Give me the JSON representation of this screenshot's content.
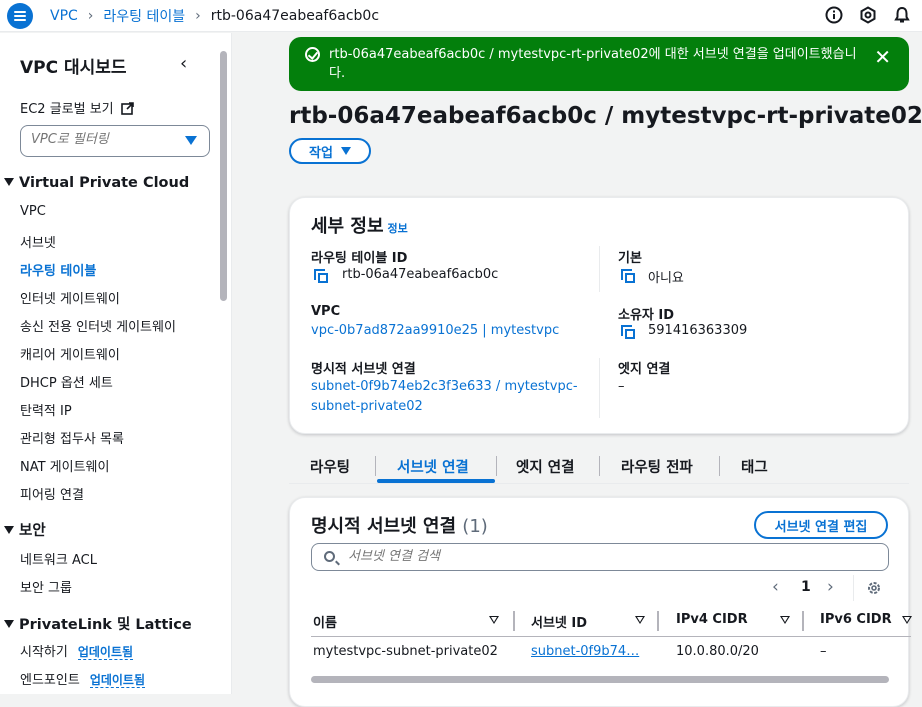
{
  "breadcrumb": {
    "root": "VPC",
    "parent": "라우팅 테이블",
    "current": "rtb-06a47eabeaf6acb0c"
  },
  "top_icons": [
    "info-circle-icon",
    "settings-icon",
    "notifications-icon"
  ],
  "sidebar": {
    "title": "VPC 대시보드",
    "ec2_link": "EC2 글로벌 보기",
    "filter_placeholder": "VPC로 필터링",
    "section_vpc": "Virtual Private Cloud",
    "items": [
      "VPC",
      "서브넷",
      "라우팅 테이블",
      "인터넷 게이트웨이",
      "송신 전용 인터넷 게이트웨이",
      "캐리어 게이트웨이",
      "DHCP 옵션 세트",
      "탄력적 IP",
      "관리형 접두사 목록",
      "NAT 게이트웨이",
      "피어링 연결"
    ],
    "section_security": "보안",
    "security_items": [
      "네트워크 ACL",
      "보안 그룹"
    ],
    "section_privatelink": "PrivateLink 및 Lattice",
    "privatelink_items": [
      {
        "label": "시작하기",
        "badge": "업데이트됨"
      },
      {
        "label": "엔드포인트",
        "badge": "업데이트됨"
      }
    ]
  },
  "flash": {
    "message": "rtb-06a47eabeaf6acb0c / mytestvpc-rt-private02에 대한 서브넷 연결을 업데이트했습니다."
  },
  "page": {
    "title": "rtb-06a47eabeaf6acb0c / mytestvpc-rt-private02",
    "actions_label": "작업"
  },
  "details": {
    "heading": "세부 정보",
    "info": "정보",
    "route_table_id_label": "라우팅 테이블 ID",
    "route_table_id": "rtb-06a47eabeaf6acb0c",
    "main_label": "기본",
    "main_value": "아니요",
    "vpc_label": "VPC",
    "vpc_value": "vpc-0b7ad872aa9910e25 | mytestvpc",
    "owner_label": "소유자 ID",
    "owner_value": "591416363309",
    "explicit_label": "명시적 서브넷 연결",
    "explicit_line1": "subnet-0f9b74eb2c3f3e633 / mytestvpc-",
    "explicit_line2": "subnet-private02",
    "edge_label": "엣지 연결",
    "edge_value": "–"
  },
  "tabs": [
    "라우팅",
    "서브넷 연결",
    "엣지 연결",
    "라우팅 전파",
    "태그"
  ],
  "assoc": {
    "heading": "명시적 서브넷 연결",
    "count": "(1)",
    "edit_label": "서브넷 연결 편집",
    "search_placeholder": "서브넷 연결 검색",
    "page": "1",
    "columns": [
      "이름",
      "서브넷 ID",
      "IPv4 CIDR",
      "IPv6 CIDR"
    ],
    "rows": [
      {
        "name": "mytestvpc-subnet-private02",
        "subnet_id": "subnet-0f9b74…",
        "ipv4": "10.0.80.0/20",
        "ipv6": "–"
      }
    ]
  }
}
